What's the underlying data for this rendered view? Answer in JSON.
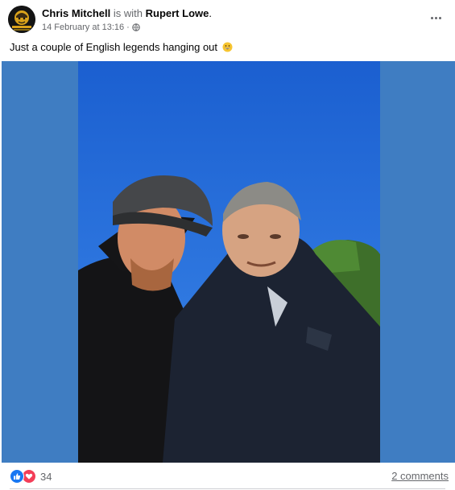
{
  "post": {
    "author": "Chris Mitchell",
    "with_text": "is with",
    "tagged": "Rupert Lowe",
    "tagged_suffix": ".",
    "timestamp": "14 February at 13:16",
    "separator": "·",
    "privacy_icon": "globe-icon",
    "caption": "Just a couple of English legends hanging out",
    "caption_emoji": "grinning-face-emoji",
    "more_icon": "more-options-icon"
  },
  "photo": {
    "description_icon": "selfie-photo",
    "background_color": "#3f7dc2"
  },
  "footer": {
    "reaction_icons": [
      "like-icon",
      "love-icon"
    ],
    "reaction_count": "34",
    "comments_label": "2 comments"
  },
  "colors": {
    "like": "#1877f2",
    "love": "#f33e58",
    "secondary_text": "#65676b"
  }
}
